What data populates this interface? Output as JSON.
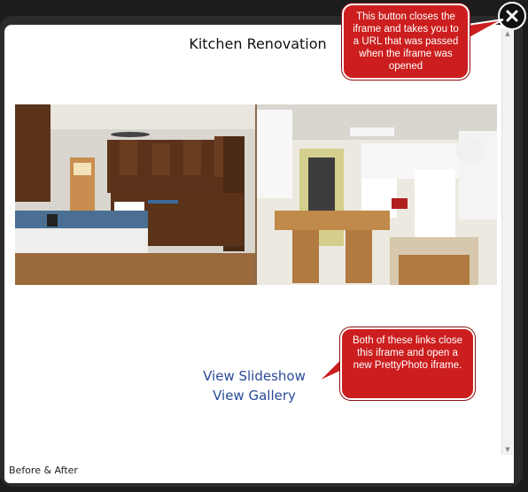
{
  "title": "Kitchen Renovation",
  "links": {
    "slideshow": "View Slideshow",
    "gallery": "View Gallery"
  },
  "footer": "Before & After",
  "callouts": {
    "close_note": "This button closes the iframe and takes you to a URL that was passed when the iframe was opened",
    "links_note": "Both of these links close this iframe and open a new PrettyPhoto iframe."
  },
  "colors": {
    "callout": "#cc1e1e",
    "link": "#2a4a9a"
  },
  "icons": {
    "close": "close-icon",
    "scroll_up": "triangle-up",
    "scroll_down": "triangle-down"
  }
}
